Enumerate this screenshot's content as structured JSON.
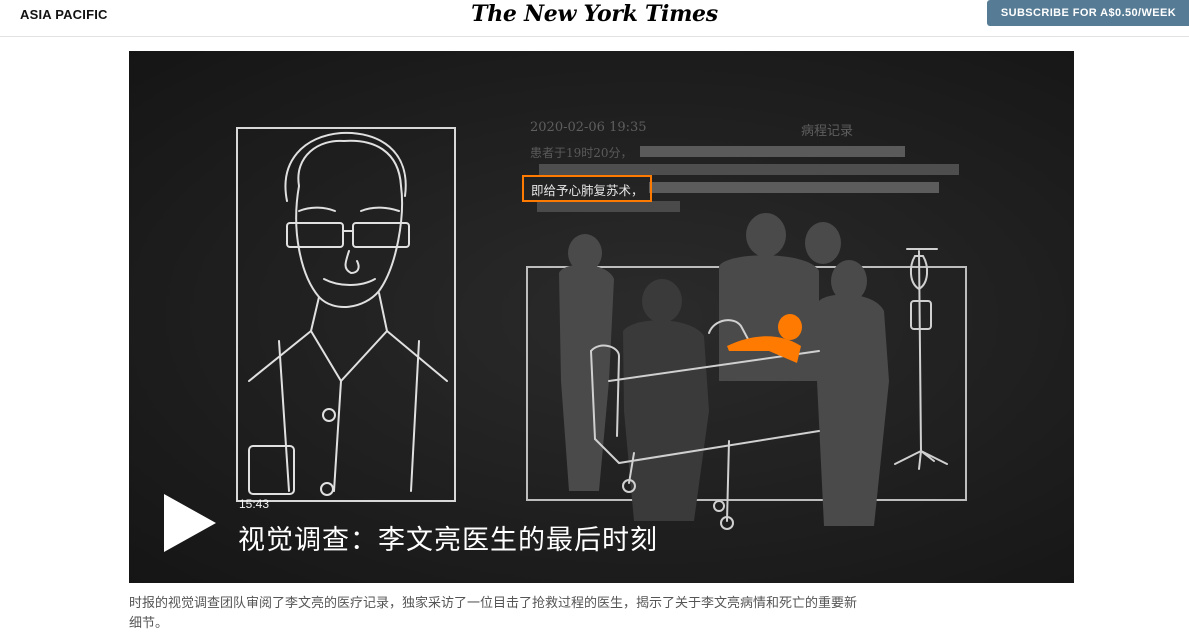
{
  "header": {
    "section": "ASIA PACIFIC",
    "logo": "The New York Times",
    "subscribe_label": "SUBSCRIBE FOR A$0.50/WEEK"
  },
  "video": {
    "duration": "15:43",
    "title": "视觉调查：李文亮医生的最后时刻",
    "document": {
      "date": "2020-02-06 19:35",
      "heading": "病程记录",
      "line1": "患者于19时20分，",
      "highlight": "即给予心肺复苏术，"
    },
    "accent_color": "#ff7a00",
    "play_icon": "play-icon"
  },
  "caption": "时报的视觉调查团队审阅了李文亮的医疗记录，独家采访了一位目击了抢救过程的医生，揭示了关于李文亮病情和死亡的重要新细节。"
}
